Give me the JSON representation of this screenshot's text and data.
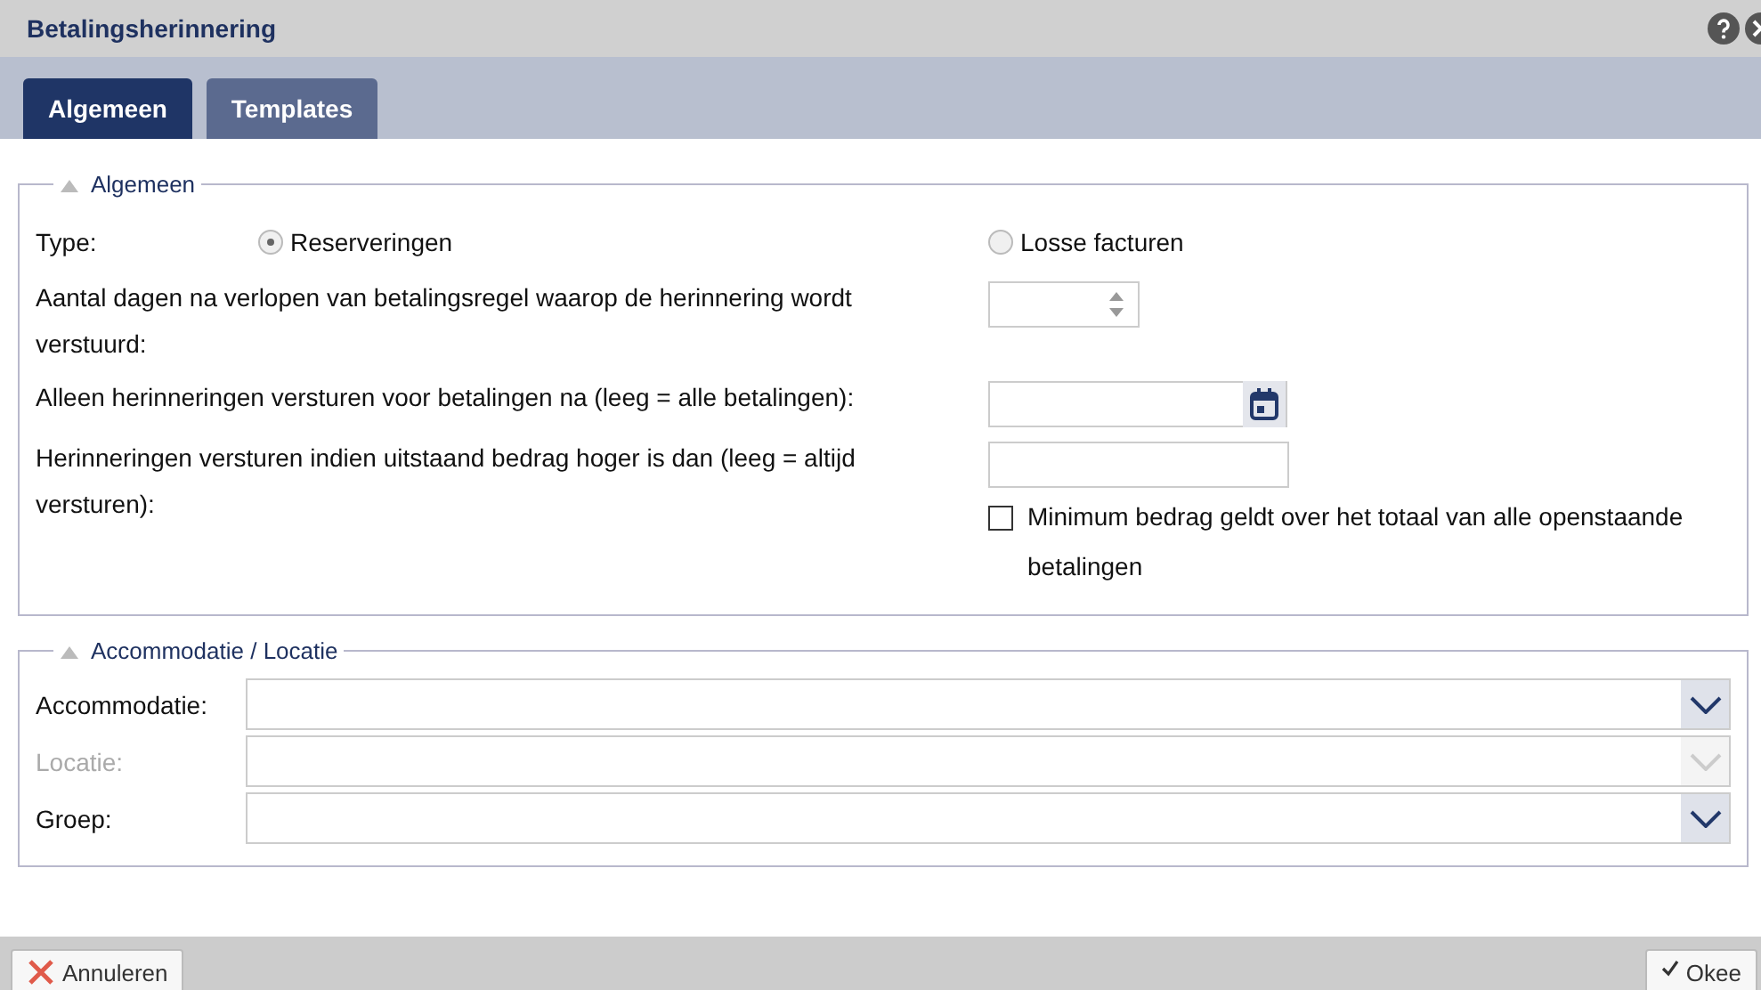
{
  "window": {
    "title": "Betalingsherinnering"
  },
  "tabs": [
    {
      "label": "Algemeen",
      "selected": true
    },
    {
      "label": "Templates",
      "selected": false
    }
  ],
  "general": {
    "legend": "Algemeen",
    "type_label": "Type:",
    "type_options": [
      {
        "label": "Reserveringen",
        "selected": true
      },
      {
        "label": "Losse facturen",
        "selected": false
      }
    ],
    "fields": [
      {
        "kind": "spinner",
        "label": "Aantal dagen na verlopen van betalingsregel waarop de herinnering wordt verstuurd:"
      },
      {
        "kind": "date",
        "label": "Alleen herinneringen versturen voor betalingen na (leeg = alle betalingen):"
      },
      {
        "kind": "text",
        "label": "Herinneringen versturen indien uitstaand bedrag hoger is dan (leeg = altijd versturen):"
      }
    ],
    "checkbox": {
      "label": "Minimum bedrag geldt over het totaal van alle openstaande betalingen",
      "checked": false
    }
  },
  "location": {
    "legend": "Accommodatie / Locatie",
    "selects": [
      {
        "label": "Accommodatie:",
        "disabled": false
      },
      {
        "label": "Locatie:",
        "disabled": true
      },
      {
        "label": "Groep:",
        "disabled": false
      }
    ]
  },
  "buttons": [
    {
      "label": "Annuleren",
      "kind": "cancel"
    },
    {
      "label": "Okee",
      "kind": "ok"
    }
  ]
}
